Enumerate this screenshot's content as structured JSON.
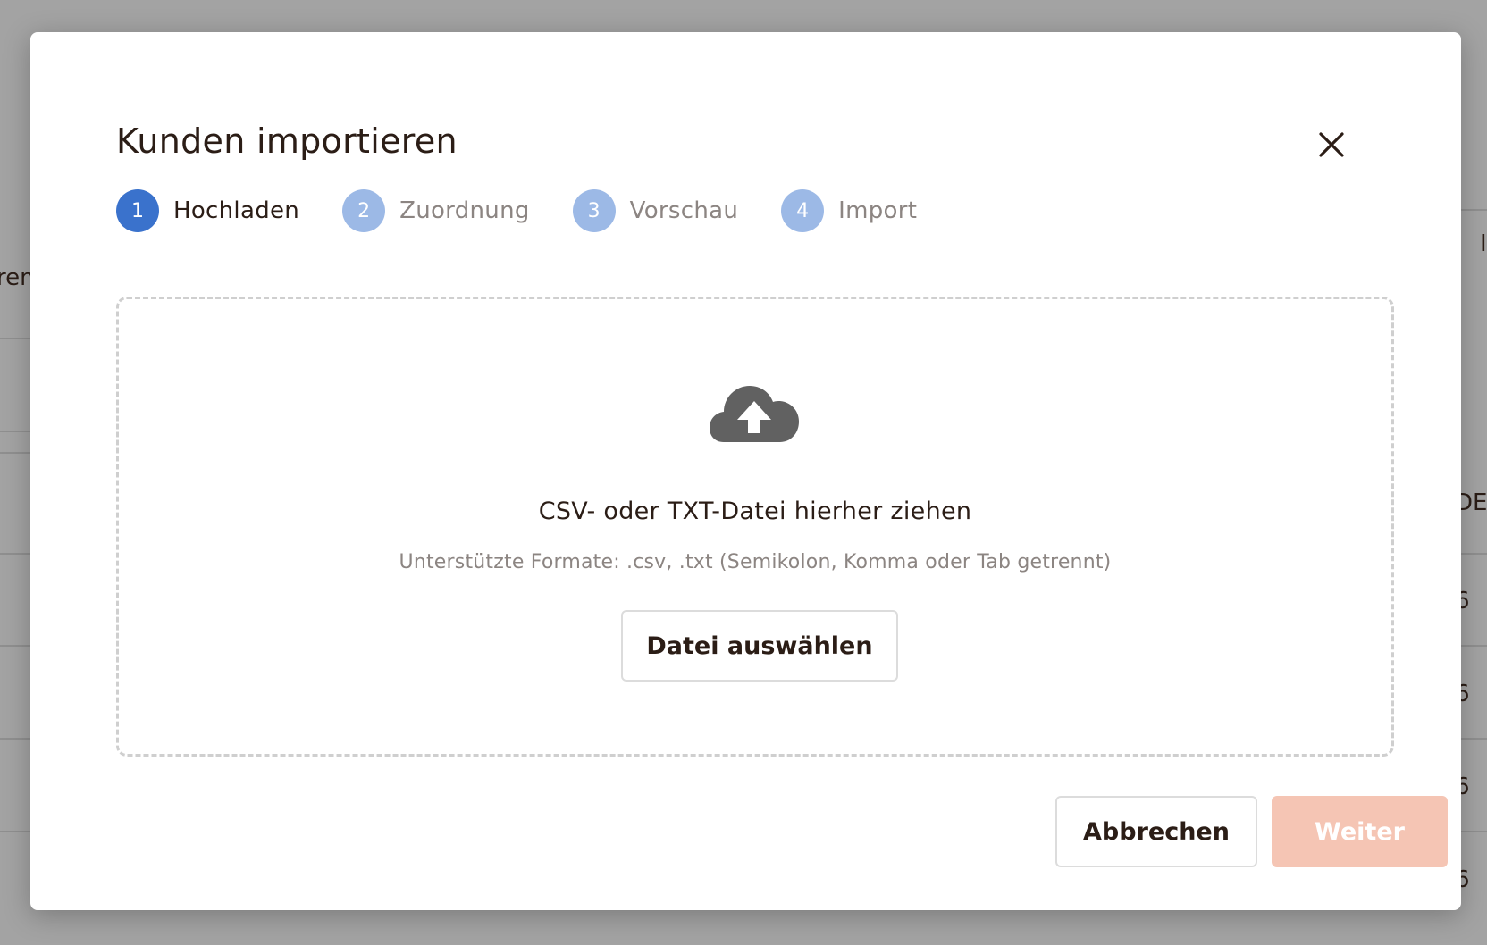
{
  "background": {
    "fragments": [
      "ren",
      "I",
      "DE",
      "6",
      "6",
      "6",
      "6"
    ]
  },
  "dialog": {
    "title": "Kunden importieren",
    "close_icon": "close-icon",
    "steps": [
      {
        "number": "1",
        "label": "Hochladen",
        "state": "active"
      },
      {
        "number": "2",
        "label": "Zuordnung",
        "state": "inactive"
      },
      {
        "number": "3",
        "label": "Vorschau",
        "state": "inactive"
      },
      {
        "number": "4",
        "label": "Import",
        "state": "inactive"
      }
    ],
    "dropzone": {
      "icon": "cloud-upload-icon",
      "title": "CSV- oder TXT-Datei hierher ziehen",
      "subtitle": "Unterstützte Formate: .csv, .txt (Semikolon, Komma oder Tab getrennt)",
      "choose_button": "Datei auswählen"
    },
    "footer": {
      "cancel_button": "Abbrechen",
      "next_button": "Weiter"
    }
  },
  "colors": {
    "overlay": "#a3a3a3",
    "text_primary": "#2b1d16",
    "text_muted": "#8c8582",
    "step_active": "#3a72cc",
    "step_inactive": "#9cb9e6",
    "next_button_disabled": "#f5c5b4",
    "icon_gray": "#616161"
  }
}
